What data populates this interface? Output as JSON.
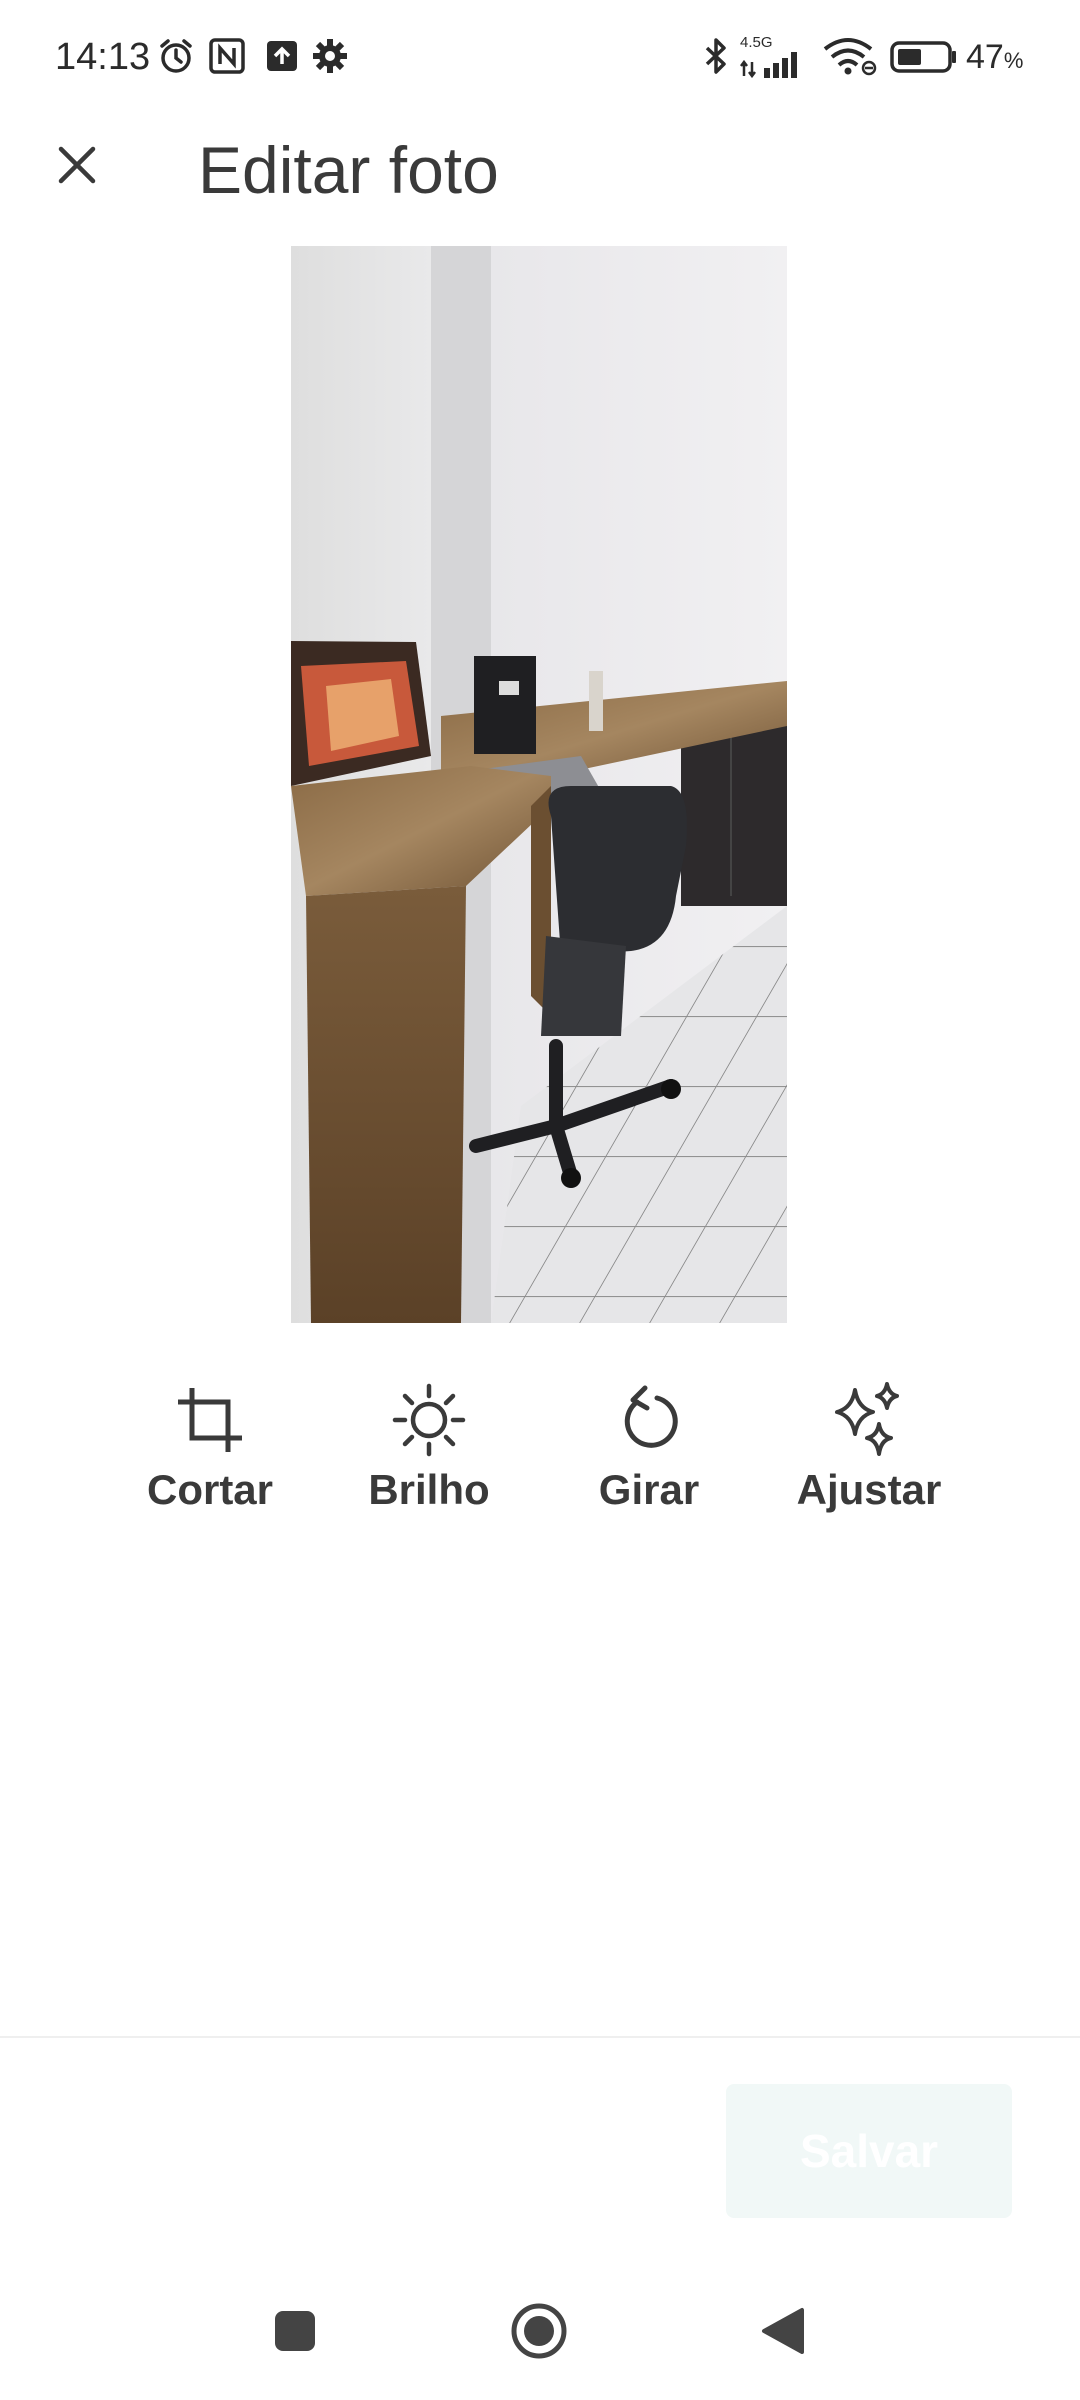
{
  "status_bar": {
    "time": "14:13",
    "network_label": "4.5G",
    "battery_percent": "47",
    "battery_unit": "%",
    "battery_level": 0.47,
    "icons": [
      "alarm-icon",
      "nfc-icon",
      "upload-icon",
      "settings-gear-icon",
      "bluetooth-icon",
      "signal-icon",
      "wifi-icon",
      "battery-icon"
    ]
  },
  "header": {
    "title": "Editar foto",
    "close_icon": "close-icon"
  },
  "tools": [
    {
      "label": "Cortar",
      "icon": "crop-icon"
    },
    {
      "label": "Brilho",
      "icon": "brightness-icon"
    },
    {
      "label": "Girar",
      "icon": "rotate-icon"
    },
    {
      "label": "Ajustar",
      "icon": "sparkle-icon"
    }
  ],
  "footer": {
    "save_label": "Salvar",
    "save_enabled": false
  },
  "nav_bar": {
    "icons": [
      "recents-square-icon",
      "home-circle-icon",
      "back-triangle-icon"
    ]
  },
  "colors": {
    "text_dark": "#3a3a3a",
    "save_button_bg": "#f1f8f7",
    "save_button_text": "#ffffff"
  }
}
